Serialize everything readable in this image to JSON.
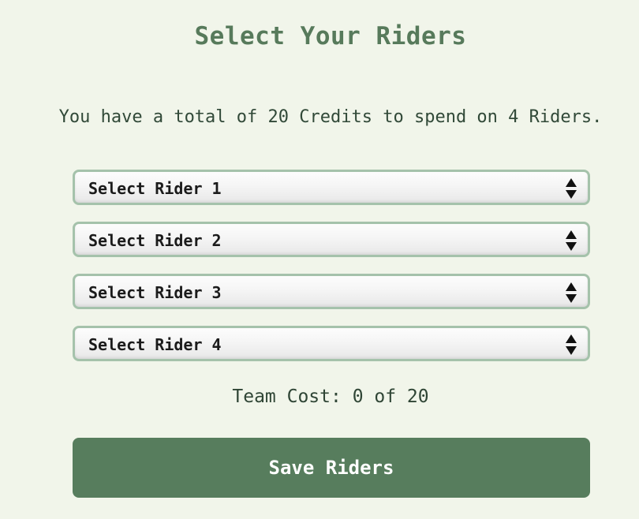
{
  "page": {
    "title": "Select Your Riders",
    "intro": "You have a total of 20 Credits to spend on 4 Riders."
  },
  "selects": [
    {
      "selected": "Select Rider 1",
      "icon": "select-arrows-icon"
    },
    {
      "selected": "Select Rider 2",
      "icon": "select-arrows-icon"
    },
    {
      "selected": "Select Rider 3",
      "icon": "select-arrows-icon"
    },
    {
      "selected": "Select Rider 4",
      "icon": "select-arrows-icon"
    }
  ],
  "team_cost": {
    "text": "Team Cost: 0 of 20",
    "spent": 0,
    "total": 20
  },
  "save_button": {
    "label": "Save Riders"
  },
  "colors": {
    "background": "#f1f5ea",
    "title": "#577a5b",
    "button": "#577d5d",
    "select_border": "#a5c2ab"
  }
}
